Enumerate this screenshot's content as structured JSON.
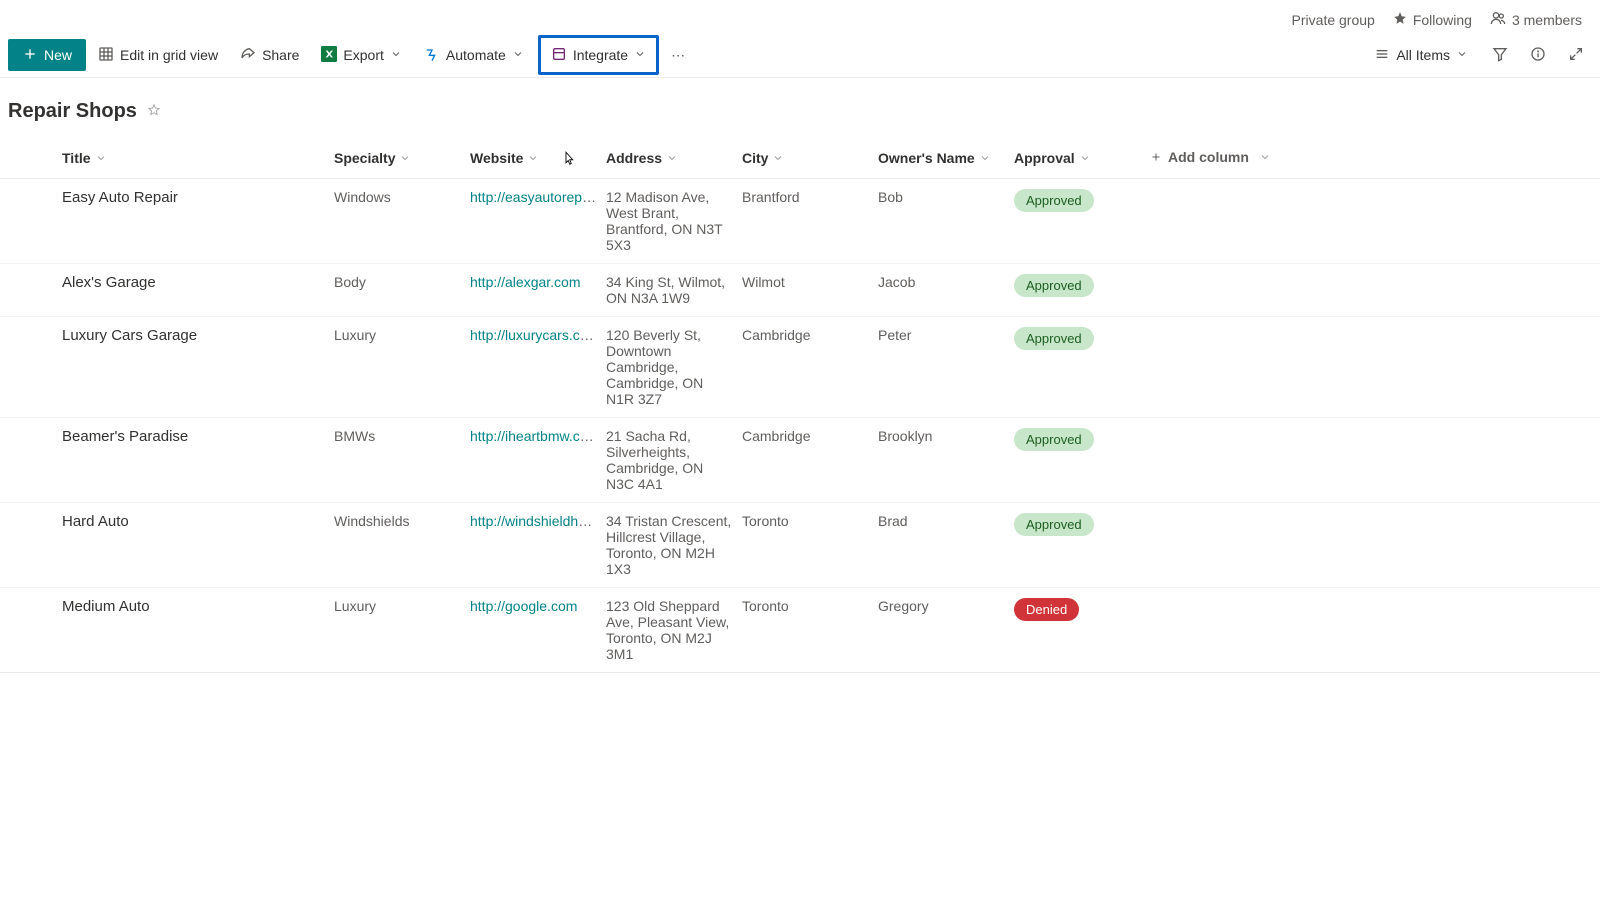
{
  "meta": {
    "group_type": "Private group",
    "following": "Following",
    "members": "3 members"
  },
  "cmd": {
    "new": "New",
    "edit_grid": "Edit in grid view",
    "share": "Share",
    "export": "Export",
    "automate": "Automate",
    "integrate": "Integrate",
    "all_items": "All Items"
  },
  "list": {
    "name": "Repair Shops"
  },
  "columns": {
    "title": "Title",
    "specialty": "Specialty",
    "website": "Website",
    "address": "Address",
    "city": "City",
    "owner": "Owner's Name",
    "approval": "Approval",
    "add": "Add column"
  },
  "rows": [
    {
      "title": "Easy Auto Repair",
      "specialty": "Windows",
      "website": "http://easyautorepair.c...",
      "address": "12 Madison Ave, West Brant, Brantford, ON N3T 5X3",
      "city": "Brantford",
      "owner": "Bob",
      "approval": "Approved",
      "approval_state": "approved"
    },
    {
      "title": "Alex's Garage",
      "specialty": "Body",
      "website": "http://alexgar.com",
      "address": "34 King St, Wilmot, ON N3A 1W9",
      "city": "Wilmot",
      "owner": "Jacob",
      "approval": "Approved",
      "approval_state": "approved"
    },
    {
      "title": "Luxury Cars Garage",
      "specialty": "Luxury",
      "website": "http://luxurycars.com",
      "address": "120 Beverly St, Downtown Cambridge, Cambridge, ON N1R 3Z7",
      "city": "Cambridge",
      "owner": "Peter",
      "approval": "Approved",
      "approval_state": "approved"
    },
    {
      "title": "Beamer's Paradise",
      "specialty": "BMWs",
      "website": "http://iheartbmw.com",
      "address": "21 Sacha Rd, Silverheights, Cambridge, ON N3C 4A1",
      "city": "Cambridge",
      "owner": "Brooklyn",
      "approval": "Approved",
      "approval_state": "approved"
    },
    {
      "title": "Hard Auto",
      "specialty": "Windshields",
      "website": "http://windshieldharda...",
      "address": "34 Tristan Crescent, Hillcrest Village, Toronto, ON M2H 1X3",
      "city": "Toronto",
      "owner": "Brad",
      "approval": "Approved",
      "approval_state": "approved"
    },
    {
      "title": "Medium Auto",
      "specialty": "Luxury",
      "website": "http://google.com",
      "address": "123 Old Sheppard Ave, Pleasant View, Toronto, ON M2J 3M1",
      "city": "Toronto",
      "owner": "Gregory",
      "approval": "Denied",
      "approval_state": "denied"
    }
  ]
}
